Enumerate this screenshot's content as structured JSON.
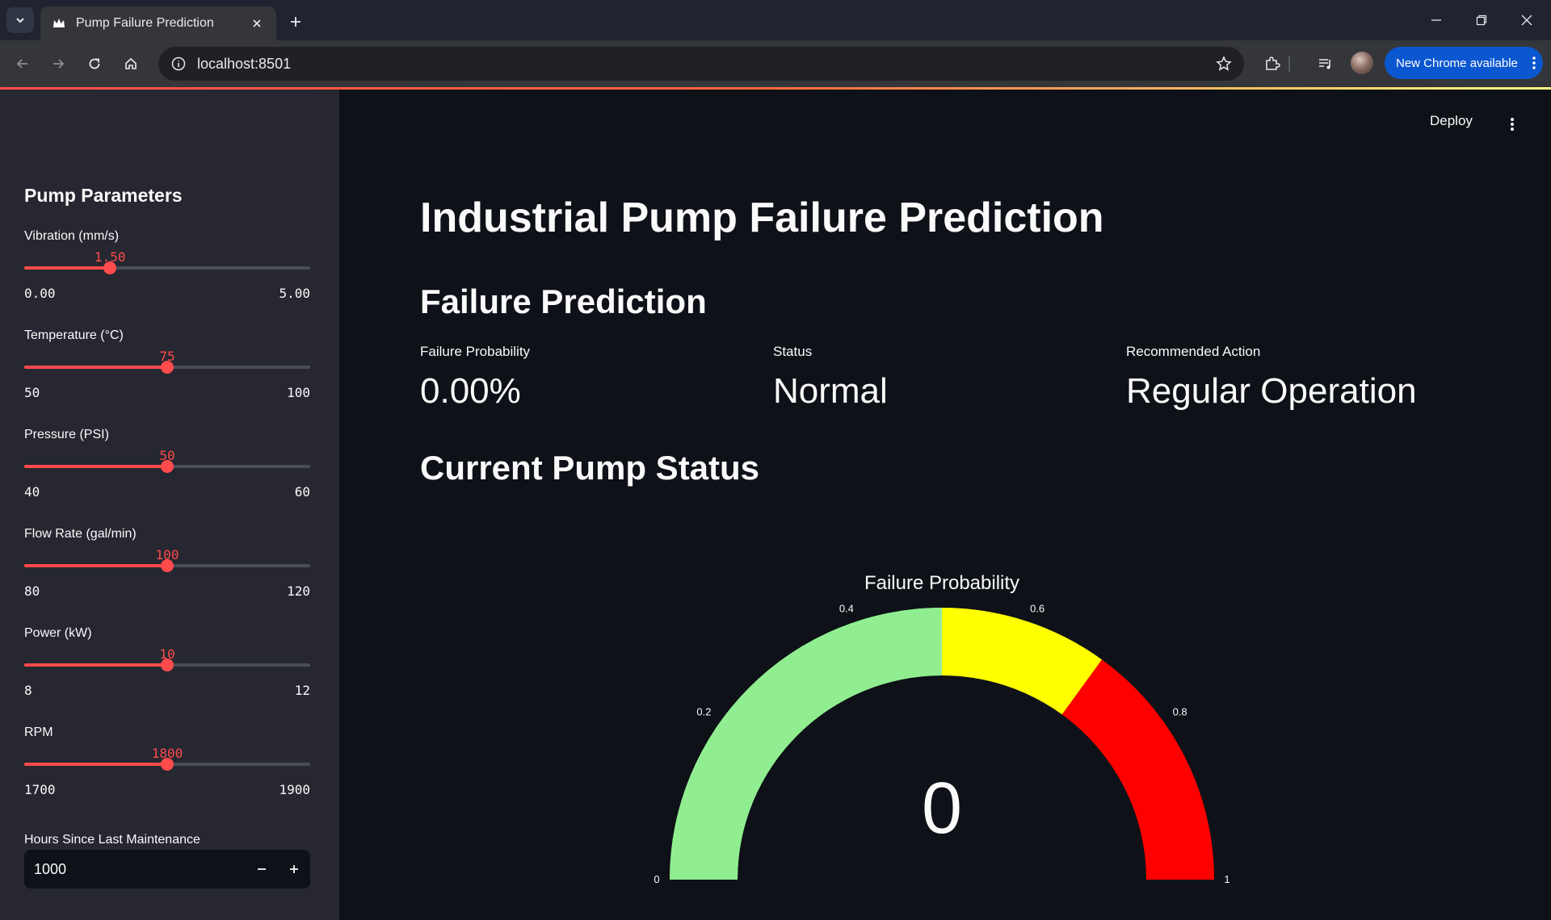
{
  "browser": {
    "tab_title": "Pump Failure Prediction",
    "url": "localhost:8501",
    "update_label": "New Chrome available"
  },
  "app": {
    "deploy_label": "Deploy",
    "title": "Industrial Pump Failure Prediction",
    "section_prediction": "Failure Prediction",
    "section_status": "Current Pump Status"
  },
  "sidebar": {
    "title": "Pump Parameters",
    "sliders": [
      {
        "label": "Vibration (mm/s)",
        "value": "1.50",
        "min": "0.00",
        "max": "5.00",
        "fraction": 0.3
      },
      {
        "label": "Temperature (°C)",
        "value": "75",
        "min": "50",
        "max": "100",
        "fraction": 0.5
      },
      {
        "label": "Pressure (PSI)",
        "value": "50",
        "min": "40",
        "max": "60",
        "fraction": 0.5
      },
      {
        "label": "Flow Rate (gal/min)",
        "value": "100",
        "min": "80",
        "max": "120",
        "fraction": 0.5
      },
      {
        "label": "Power (kW)",
        "value": "10",
        "min": "8",
        "max": "12",
        "fraction": 0.5
      },
      {
        "label": "RPM",
        "value": "1800",
        "min": "1700",
        "max": "1900",
        "fraction": 0.5
      }
    ],
    "hours": {
      "label": "Hours Since Last Maintenance",
      "value": "1000"
    }
  },
  "metrics": [
    {
      "label": "Failure Probability",
      "value": "0.00%"
    },
    {
      "label": "Status",
      "value": "Normal"
    },
    {
      "label": "Recommended Action",
      "value": "Regular Operation"
    }
  ],
  "chart_data": {
    "type": "gauge",
    "title": "Failure Probability",
    "value": 0,
    "value_label": "0",
    "range": [
      0,
      1
    ],
    "ticks": [
      "0",
      "0.2",
      "0.4",
      "0.6",
      "0.8",
      "1"
    ],
    "tick_values": [
      0,
      0.2,
      0.4,
      0.6,
      0.8,
      1
    ],
    "steps": [
      {
        "range": [
          0,
          0.5
        ],
        "color": "#90ee90"
      },
      {
        "range": [
          0,
          0.5
        ],
        "color": "#90ee90"
      },
      {
        "range": [
          0.5,
          0.7
        ],
        "color": "#ffff00"
      },
      {
        "range": [
          0.7,
          1
        ],
        "color": "#ff0000"
      }
    ]
  }
}
